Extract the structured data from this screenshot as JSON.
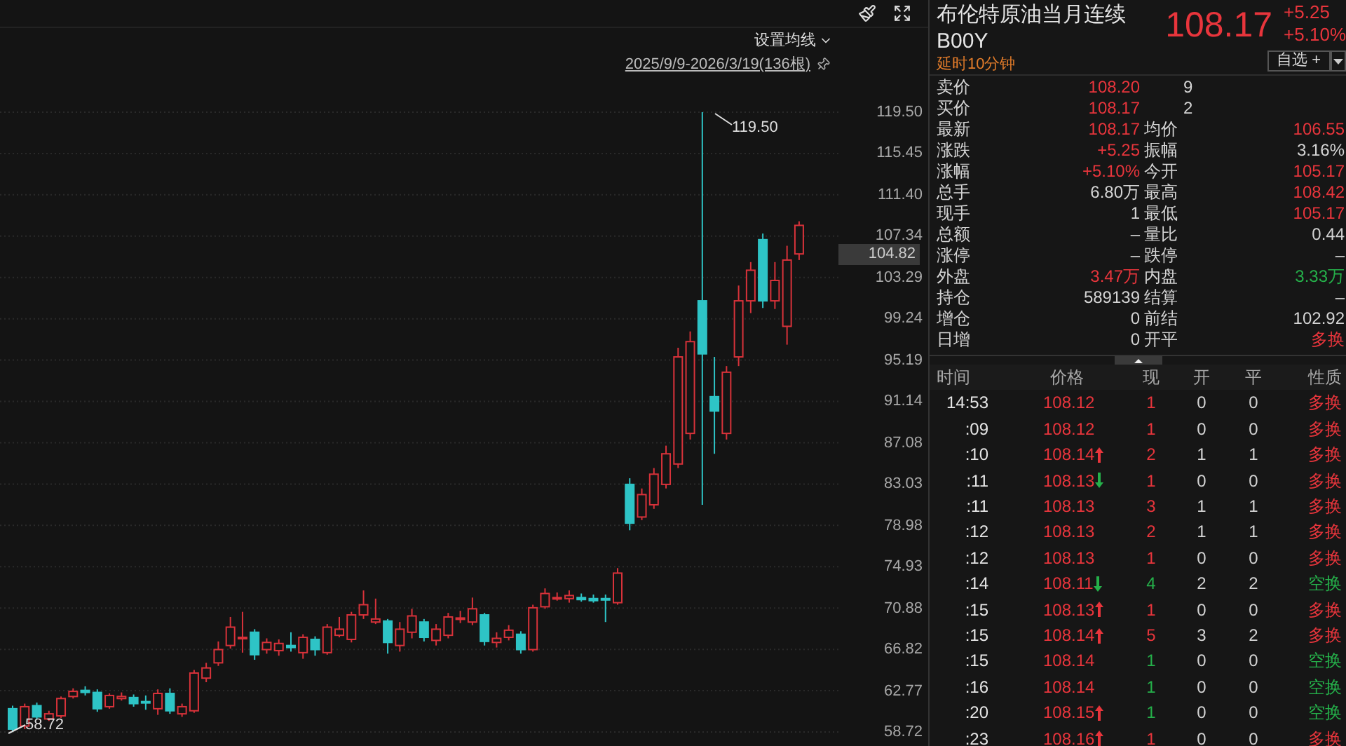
{
  "chart": {
    "ma_settings": "设置均线",
    "date_range": "2025/9/9-2026/3/19(136根)",
    "current_price_tag": "104.82",
    "high_annotation": "119.50",
    "low_annotation": "58.72",
    "chart_data": {
      "type": "candlestick",
      "ohlc": [
        [
          61,
          61.3,
          58.72,
          59
        ],
        [
          59.3,
          61.5,
          59,
          61.2
        ],
        [
          61.3,
          61.6,
          60,
          60.2
        ],
        [
          60,
          60.8,
          59.8,
          60.5
        ],
        [
          60.3,
          62.2,
          60.1,
          62
        ],
        [
          62.2,
          63,
          62,
          62.7
        ],
        [
          62.8,
          63.2,
          62.3,
          62.6
        ],
        [
          62.6,
          62.9,
          60.7,
          61
        ],
        [
          61.2,
          62.5,
          61,
          62.3
        ],
        [
          62,
          62.6,
          61.8,
          62.2
        ],
        [
          62.1,
          62.4,
          61.2,
          61.5
        ],
        [
          61.7,
          62.3,
          60.9,
          61.6
        ],
        [
          61,
          62.9,
          60.4,
          62.5
        ],
        [
          62.5,
          63,
          60.5,
          60.8
        ],
        [
          60.5,
          61.5,
          60.2,
          61.2
        ],
        [
          60.8,
          64.8,
          60.6,
          64.5
        ],
        [
          64,
          65.5,
          63.6,
          65
        ],
        [
          65.5,
          67.6,
          65.2,
          66.8
        ],
        [
          67.2,
          70,
          66.9,
          69
        ],
        [
          68,
          70.5,
          66.5,
          68
        ],
        [
          68.5,
          68.8,
          65.8,
          66.3
        ],
        [
          66.8,
          67.9,
          66.4,
          67.5
        ],
        [
          66.7,
          67.8,
          66.2,
          67.4
        ],
        [
          67.2,
          68.5,
          66.6,
          67
        ],
        [
          66.5,
          68.3,
          65.9,
          68
        ],
        [
          67.8,
          68.1,
          66.2,
          66.8
        ],
        [
          66.5,
          69.3,
          66.3,
          69
        ],
        [
          68.2,
          70,
          68,
          68.8
        ],
        [
          67.8,
          70.5,
          67.5,
          70.2
        ],
        [
          70.2,
          72.6,
          69.8,
          71.2
        ],
        [
          69.5,
          71.8,
          69.3,
          69.8
        ],
        [
          69.6,
          69.8,
          66.4,
          67.5
        ],
        [
          67.2,
          69.5,
          66.6,
          68.8
        ],
        [
          68.5,
          70.8,
          67.9,
          70.1
        ],
        [
          69.5,
          69.8,
          67.6,
          68
        ],
        [
          67.7,
          69.3,
          67.2,
          68.8
        ],
        [
          68.2,
          70.4,
          67.9,
          70
        ],
        [
          69.8,
          70.6,
          69.4,
          69.9
        ],
        [
          69.5,
          71.9,
          69.2,
          70.8
        ],
        [
          70.2,
          70.4,
          67.2,
          67.6
        ],
        [
          67.5,
          68.5,
          67,
          67.9
        ],
        [
          68,
          69.2,
          67.7,
          68.7
        ],
        [
          68.3,
          68.6,
          66.4,
          66.8
        ],
        [
          66.8,
          71.2,
          66.6,
          70.9
        ],
        [
          71,
          72.8,
          70.8,
          72.3
        ],
        [
          71.9,
          72.4,
          71.6,
          71.9
        ],
        [
          71.8,
          72.6,
          71.4,
          72.1
        ],
        [
          71.9,
          72.3,
          71.5,
          71.7
        ],
        [
          71.8,
          72.2,
          71.4,
          71.6
        ],
        [
          71.8,
          72.2,
          69.5,
          71.7
        ],
        [
          71.4,
          74.8,
          71.2,
          74.3
        ],
        [
          83,
          83.6,
          78.5,
          79.2
        ],
        [
          79.8,
          82.6,
          79.5,
          82
        ],
        [
          81,
          84.6,
          80.6,
          84
        ],
        [
          83,
          86.8,
          82.6,
          86
        ],
        [
          85,
          96.4,
          84.6,
          95.5
        ],
        [
          88,
          98,
          87.4,
          97
        ],
        [
          101,
          119.5,
          81,
          95.8
        ],
        [
          91.6,
          95.5,
          86,
          90.2
        ],
        [
          88,
          94.6,
          87.4,
          94
        ],
        [
          95.5,
          102.5,
          94.6,
          101
        ],
        [
          101,
          104.8,
          99.8,
          104
        ],
        [
          107,
          107.6,
          100.3,
          101
        ],
        [
          101,
          104.8,
          100.2,
          103
        ],
        [
          98.5,
          106.4,
          96.7,
          105
        ],
        [
          105.6,
          108.8,
          105,
          108.4
        ]
      ],
      "ylim": [
        58.72,
        119.5
      ],
      "grid": true,
      "yticks": [
        {
          "value": 119.5,
          "label": "119.50"
        },
        {
          "value": 115.45,
          "label": "115.45"
        },
        {
          "value": 111.4,
          "label": "111.40"
        },
        {
          "value": 107.34,
          "label": "107.34"
        },
        {
          "value": 103.29,
          "label": "103.29"
        },
        {
          "value": 99.24,
          "label": "99.24"
        },
        {
          "value": 95.19,
          "label": "95.19"
        },
        {
          "value": 91.14,
          "label": "91.14"
        },
        {
          "value": 87.08,
          "label": "87.08"
        },
        {
          "value": 83.03,
          "label": "83.03"
        },
        {
          "value": 78.98,
          "label": "78.98"
        },
        {
          "value": 74.93,
          "label": "74.93"
        },
        {
          "value": 70.88,
          "label": "70.88"
        },
        {
          "value": 66.82,
          "label": "66.82"
        },
        {
          "value": 62.77,
          "label": "62.77"
        },
        {
          "value": 58.72,
          "label": "58.72"
        }
      ]
    }
  },
  "header": {
    "name": "布伦特原油当月连续",
    "code": "B00Y",
    "delay_note": "延时10分钟",
    "price": "108.17",
    "change": "+5.25",
    "change_pct": "+5.10%",
    "watchlist_button": "自选 +"
  },
  "bid_ask": [
    {
      "label": "卖价",
      "price": "108.20",
      "volume": "9"
    },
    {
      "label": "买价",
      "price": "108.17",
      "volume": "2"
    }
  ],
  "stats": [
    {
      "cells": [
        {
          "label": "最新",
          "value": "108.17",
          "up": true,
          "down": false
        },
        {
          "label": "均价",
          "value": "106.55",
          "up": true,
          "down": false
        }
      ]
    },
    {
      "cells": [
        {
          "label": "涨跌",
          "value": "+5.25",
          "up": true,
          "down": false
        },
        {
          "label": "振幅",
          "value": "3.16%",
          "up": false,
          "down": false
        }
      ]
    },
    {
      "cells": [
        {
          "label": "涨幅",
          "value": "+5.10%",
          "up": true,
          "down": false
        },
        {
          "label": "今开",
          "value": "105.17",
          "up": true,
          "down": false
        }
      ]
    },
    {
      "cells": [
        {
          "label": "总手",
          "value": "6.80万",
          "up": false,
          "down": false
        },
        {
          "label": "最高",
          "value": "108.42",
          "up": true,
          "down": false
        }
      ]
    },
    {
      "cells": [
        {
          "label": "现手",
          "value": "1",
          "up": false,
          "down": false
        },
        {
          "label": "最低",
          "value": "105.17",
          "up": true,
          "down": false
        }
      ]
    },
    {
      "cells": [
        {
          "label": "总额",
          "value": "–",
          "up": false,
          "down": false
        },
        {
          "label": "量比",
          "value": "0.44",
          "up": false,
          "down": false
        }
      ]
    },
    {
      "cells": [
        {
          "label": "涨停",
          "value": "–",
          "up": false,
          "down": false
        },
        {
          "label": "跌停",
          "value": "–",
          "up": false,
          "down": false
        }
      ]
    },
    {
      "cells": [
        {
          "label": "外盘",
          "value": "3.47万",
          "up": true,
          "down": false
        },
        {
          "label": "内盘",
          "value": "3.33万",
          "up": false,
          "down": true
        }
      ]
    },
    {
      "cells": [
        {
          "label": "持仓",
          "value": "589139",
          "up": false,
          "down": false
        },
        {
          "label": "结算",
          "value": "–",
          "up": false,
          "down": false
        }
      ]
    },
    {
      "cells": [
        {
          "label": "增仓",
          "value": "0",
          "up": false,
          "down": false
        },
        {
          "label": "前结",
          "value": "102.92",
          "up": false,
          "down": false
        }
      ]
    },
    {
      "cells": [
        {
          "label": "日增",
          "value": "0",
          "up": false,
          "down": false
        },
        {
          "label": "开平",
          "value": "多换",
          "up": true,
          "down": false
        }
      ]
    }
  ],
  "trades": {
    "columns": [
      "时间",
      "价格",
      "现",
      "开",
      "平",
      "性质"
    ],
    "rows": [
      {
        "time": "14:53",
        "price": "108.12",
        "arrow_up": false,
        "arrow_down": false,
        "volume": "1",
        "volume_up": true,
        "open": "0",
        "close": "0",
        "nature": "多换",
        "nature_long": true
      },
      {
        "time": ":09",
        "price": "108.12",
        "arrow_up": false,
        "arrow_down": false,
        "volume": "1",
        "volume_up": true,
        "open": "0",
        "close": "0",
        "nature": "多换",
        "nature_long": true
      },
      {
        "time": ":10",
        "price": "108.14",
        "arrow_up": true,
        "arrow_down": false,
        "volume": "2",
        "volume_up": true,
        "open": "1",
        "close": "1",
        "nature": "多换",
        "nature_long": true
      },
      {
        "time": ":11",
        "price": "108.13",
        "arrow_up": false,
        "arrow_down": true,
        "volume": "1",
        "volume_up": true,
        "open": "0",
        "close": "0",
        "nature": "多换",
        "nature_long": true
      },
      {
        "time": ":11",
        "price": "108.13",
        "arrow_up": false,
        "arrow_down": false,
        "volume": "3",
        "volume_up": true,
        "open": "1",
        "close": "1",
        "nature": "多换",
        "nature_long": true
      },
      {
        "time": ":12",
        "price": "108.13",
        "arrow_up": false,
        "arrow_down": false,
        "volume": "2",
        "volume_up": true,
        "open": "1",
        "close": "1",
        "nature": "多换",
        "nature_long": true
      },
      {
        "time": ":12",
        "price": "108.13",
        "arrow_up": false,
        "arrow_down": false,
        "volume": "1",
        "volume_up": true,
        "open": "0",
        "close": "0",
        "nature": "多换",
        "nature_long": true
      },
      {
        "time": ":14",
        "price": "108.11",
        "arrow_up": false,
        "arrow_down": true,
        "volume": "4",
        "volume_up": false,
        "open": "2",
        "close": "2",
        "nature": "空换",
        "nature_long": false
      },
      {
        "time": ":15",
        "price": "108.13",
        "arrow_up": true,
        "arrow_down": false,
        "volume": "1",
        "volume_up": true,
        "open": "0",
        "close": "0",
        "nature": "多换",
        "nature_long": true
      },
      {
        "time": ":15",
        "price": "108.14",
        "arrow_up": true,
        "arrow_down": false,
        "volume": "5",
        "volume_up": true,
        "open": "3",
        "close": "2",
        "nature": "多换",
        "nature_long": true
      },
      {
        "time": ":15",
        "price": "108.14",
        "arrow_up": false,
        "arrow_down": false,
        "volume": "1",
        "volume_up": false,
        "open": "0",
        "close": "0",
        "nature": "空换",
        "nature_long": false
      },
      {
        "time": ":16",
        "price": "108.14",
        "arrow_up": false,
        "arrow_down": false,
        "volume": "1",
        "volume_up": false,
        "open": "0",
        "close": "0",
        "nature": "空换",
        "nature_long": false
      },
      {
        "time": ":20",
        "price": "108.15",
        "arrow_up": true,
        "arrow_down": false,
        "volume": "1",
        "volume_up": false,
        "open": "0",
        "close": "0",
        "nature": "空换",
        "nature_long": false
      },
      {
        "time": ":23",
        "price": "108.16",
        "arrow_up": true,
        "arrow_down": false,
        "volume": "1",
        "volume_up": true,
        "open": "0",
        "close": "0",
        "nature": "多换",
        "nature_long": true
      }
    ]
  }
}
